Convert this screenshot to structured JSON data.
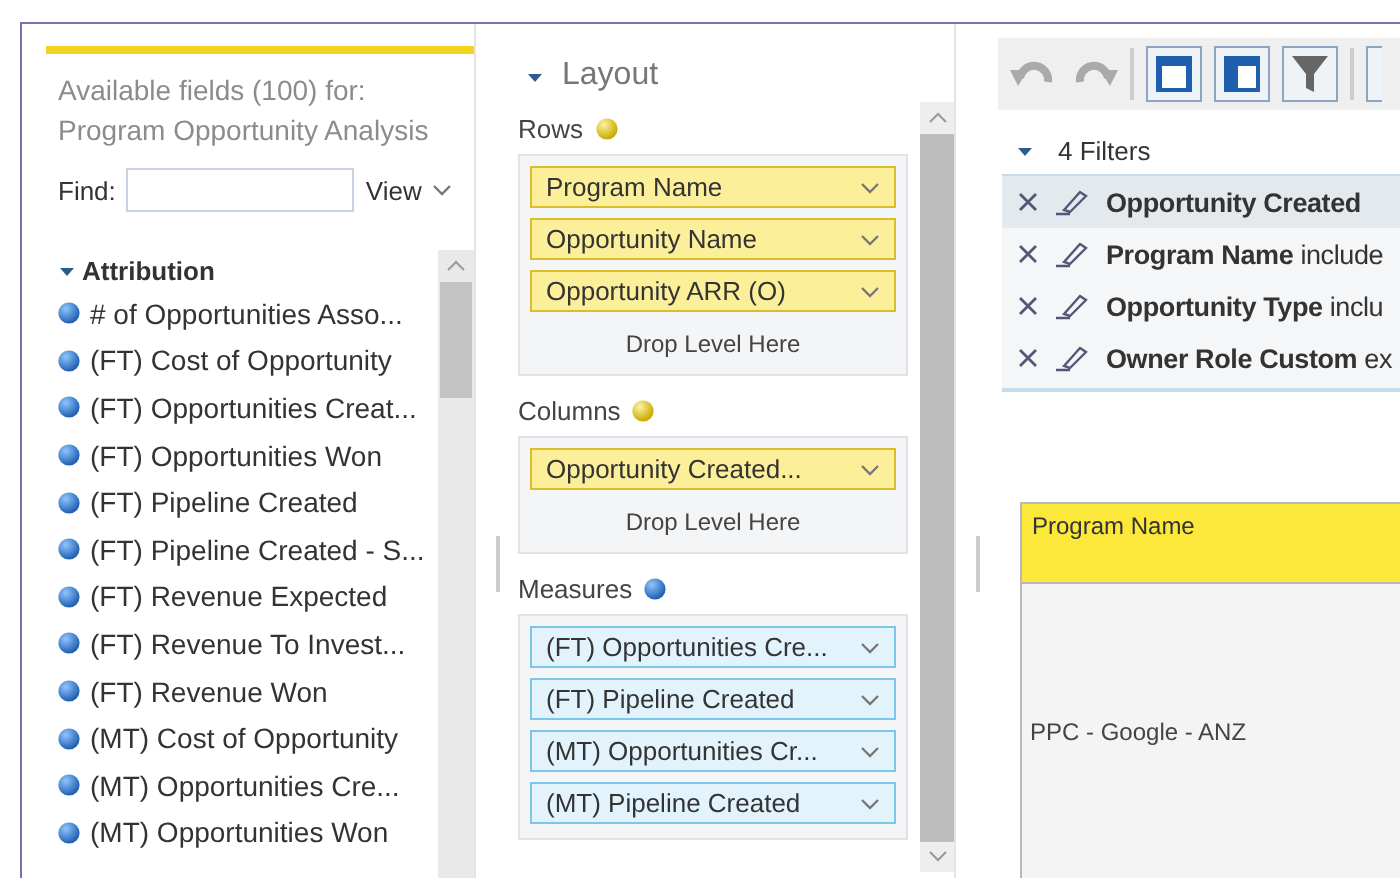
{
  "fields_panel": {
    "title_lines": [
      "Available fields (100) for:",
      "Program Opportunity Analysis"
    ],
    "find": {
      "label": "Find:"
    },
    "view_menu": "View",
    "folder": {
      "label": "Attribution",
      "expanded": true,
      "children": [
        {
          "label": "# of Opportunities Asso..."
        },
        {
          "label": "(FT) Cost of Opportunity"
        },
        {
          "label": "(FT) Opportunities Creat..."
        },
        {
          "label": "(FT) Opportunities Won"
        },
        {
          "label": "(FT) Pipeline Created"
        },
        {
          "label": "(FT) Pipeline Created - S..."
        },
        {
          "label": "(FT) Revenue Expected"
        },
        {
          "label": "(FT) Revenue To Invest..."
        },
        {
          "label": "(FT) Revenue Won"
        },
        {
          "label": "(MT) Cost of Opportunity"
        },
        {
          "label": "(MT) Opportunities Cre..."
        },
        {
          "label": "(MT) Opportunities Won"
        }
      ]
    }
  },
  "layout_panel": {
    "title": "Layout",
    "expanded": true,
    "sections": [
      {
        "label": "Rows",
        "kind": "dimension",
        "items": [
          "Program Name",
          "Opportunity Name",
          "Opportunity ARR (O)"
        ],
        "drop_hint": "Drop Level Here"
      },
      {
        "label": "Columns",
        "kind": "dimension",
        "items": [
          "Opportunity Created..."
        ],
        "drop_hint": "Drop Level Here"
      },
      {
        "label": "Measures",
        "kind": "measure",
        "items": [
          "(FT) Opportunities Cre...",
          "(FT) Pipeline Created",
          "(MT) Opportunities Cr...",
          "(MT) Pipeline Created"
        ]
      }
    ]
  },
  "report_panel": {
    "filters": {
      "title": "4 Filters",
      "expanded": true,
      "items": [
        {
          "text": "**Opportunity Created**",
          "selected": true
        },
        {
          "text": "**Program Name** include",
          "selected": false
        },
        {
          "text": "**Opportunity Type** inclu",
          "selected": false
        },
        {
          "text": "**Owner Role Custom** ex",
          "selected": false
        }
      ]
    },
    "table": {
      "header": "Program Name",
      "cell": "PPC - Google - ANZ"
    }
  }
}
